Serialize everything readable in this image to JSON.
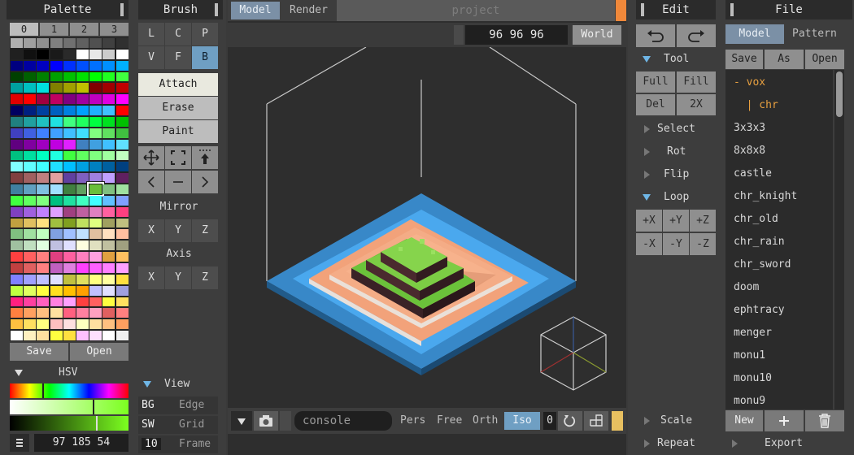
{
  "palette": {
    "title": "Palette",
    "tabs": [
      "0",
      "1",
      "2",
      "3"
    ],
    "save_label": "Save",
    "open_label": "Open",
    "hsv_label": "HSV",
    "color_value": "97 185 54",
    "colors": [
      [
        "#b0b0b0",
        "#a0a0a0",
        "#909090",
        "#808080",
        "#707070",
        "#606060",
        "#505050",
        "#404040",
        "#303030"
      ],
      [
        "#202020",
        "#101010",
        "#000000",
        "#1a1a1a",
        "#2a2a2a",
        "#ffffff",
        "#e8e8e8",
        "#cccccc",
        "#ffffff"
      ],
      [
        "#000080",
        "#0000a0",
        "#0000c0",
        "#0000ff",
        "#0030ff",
        "#0050ff",
        "#0070ff",
        "#0090ff",
        "#00b0ff"
      ],
      [
        "#004000",
        "#006000",
        "#008000",
        "#00a000",
        "#00c000",
        "#00e000",
        "#00ff00",
        "#20ff20",
        "#40ff40"
      ],
      [
        "#00a0a0",
        "#00c0c0",
        "#00e0e0",
        "#808000",
        "#a0a000",
        "#c0c000",
        "#800000",
        "#a00000",
        "#c00000"
      ],
      [
        "#e00000",
        "#ff0000",
        "#a00040",
        "#c00060",
        "#800080",
        "#a000a0",
        "#c000c0",
        "#e000e0",
        "#ff00ff"
      ],
      [
        "#000060",
        "#002080",
        "#0040a0",
        "#0060c0",
        "#0080e0",
        "#00a0ff",
        "#20b0ff",
        "#40c0ff",
        "#ff0000"
      ],
      [
        "#208080",
        "#20a0a0",
        "#20c0c0",
        "#20e0e0",
        "#40ff80",
        "#20ff60",
        "#00ff40",
        "#00e020",
        "#00c000"
      ],
      [
        "#4040c0",
        "#4060e0",
        "#4080ff",
        "#40a0ff",
        "#40c0ff",
        "#40e0ff",
        "#80ff80",
        "#60e060",
        "#40c040"
      ],
      [
        "#600080",
        "#8000a0",
        "#a000c0",
        "#c000e0",
        "#e020ff",
        "#4080c0",
        "#40a0e0",
        "#40c0ff",
        "#60e0ff"
      ],
      [
        "#00c080",
        "#00e0a0",
        "#00ffc0",
        "#20ffe0",
        "#40ff40",
        "#60ff60",
        "#80ff80",
        "#a0ffa0",
        "#c0ffc0"
      ],
      [
        "#80ffff",
        "#60ffff",
        "#40ffff",
        "#20e0ff",
        "#00c0ff",
        "#00a0e0",
        "#0080c0",
        "#0060a0",
        "#004080"
      ],
      [
        "#804040",
        "#a06060",
        "#c08080",
        "#e0a0a0",
        "#6040a0",
        "#8060c0",
        "#a080e0",
        "#c0a0ff",
        "#602060"
      ],
      [
        "#4080a0",
        "#60a0c0",
        "#80c0e0",
        "#a0e0ff",
        "#408040",
        "#60a060",
        "#6abf3a",
        "#80c080",
        "#a0e0a0"
      ],
      [
        "#40ff40",
        "#60ff60",
        "#80ff80",
        "#00c080",
        "#20e0a0",
        "#40ffc0",
        "#40ffff",
        "#60c0ff",
        "#80a0ff"
      ],
      [
        "#8040c0",
        "#a060e0",
        "#c080ff",
        "#e0a0ff",
        "#a04080",
        "#c060a0",
        "#e080c0",
        "#ff60a0",
        "#ff4080"
      ],
      [
        "#c0a040",
        "#e0c060",
        "#ffe080",
        "#a0c040",
        "#80a020",
        "#c0e060",
        "#e0ff80",
        "#a0a060",
        "#c0c080"
      ],
      [
        "#80c080",
        "#a0e0a0",
        "#c0ffc0",
        "#80a0e0",
        "#a0c0ff",
        "#c0e0ff",
        "#e0c0a0",
        "#ffe0c0",
        "#ffc0a0"
      ],
      [
        "#a0c0a0",
        "#c0e0c0",
        "#e0ffe0",
        "#c0c0e0",
        "#e0e0ff",
        "#ffffe0",
        "#e0e0c0",
        "#c0c0a0",
        "#a0a080"
      ],
      [
        "#ff4040",
        "#ff6060",
        "#ff8080",
        "#e04080",
        "#ff60a0",
        "#ff80c0",
        "#ffa0e0",
        "#e0a040",
        "#ffc060"
      ],
      [
        "#c04040",
        "#e06060",
        "#ff8080",
        "#c060c0",
        "#e080e0",
        "#ff40ff",
        "#ff60ff",
        "#ff80ff",
        "#ffa0ff"
      ],
      [
        "#8080ff",
        "#a0a0ff",
        "#c0c0ff",
        "#e0e0ff",
        "#c0c040",
        "#e0e060",
        "#ffff80",
        "#ffffa0",
        "#ffe040"
      ],
      [
        "#c0ff40",
        "#e0ff60",
        "#ffff40",
        "#ffe020",
        "#ffc000",
        "#ffa000",
        "#c0c0ff",
        "#e0e0ff",
        "#a0a0e0"
      ],
      [
        "#ff2080",
        "#ff40a0",
        "#ff60c0",
        "#ff80e0",
        "#ffa0ff",
        "#ff4040",
        "#ff6060",
        "#ffff40",
        "#ffe060"
      ],
      [
        "#ff8040",
        "#ffa060",
        "#ffc080",
        "#ffe0a0",
        "#ff6080",
        "#ff80a0",
        "#ffa0c0",
        "#e06060",
        "#ff8080"
      ],
      [
        "#ffc040",
        "#ffe060",
        "#ffff80",
        "#ffc0c0",
        "#ffe0e0",
        "#ffffc0",
        "#ffe0a0",
        "#ffc080",
        "#ffa060"
      ],
      [
        "#ffffff",
        "#fff0c0",
        "#ffe0a0",
        "#ffff40",
        "#ffe040",
        "#ffc0ff",
        "#ffe0ff",
        "#ffffff",
        "#f0f0f0"
      ]
    ]
  },
  "brush": {
    "title": "Brush",
    "modes_row1": [
      "L",
      "C",
      "P"
    ],
    "modes_row2": [
      "V",
      "F",
      "B"
    ],
    "actions": [
      "Attach",
      "Erase",
      "Paint"
    ],
    "mirror_label": "Mirror",
    "axis_label": "Axis",
    "axes": [
      "X",
      "Y",
      "Z"
    ],
    "view_label": "View",
    "view_rows": [
      {
        "key": "BG",
        "value": "Edge"
      },
      {
        "key": "SW",
        "value": "Grid"
      },
      {
        "key": "10",
        "value": "Frame"
      }
    ]
  },
  "viewport": {
    "tabs": [
      "Model",
      "Render"
    ],
    "project_placeholder": "project",
    "dims": "96 96 96",
    "space_label": "World",
    "console_placeholder": "console",
    "camera_modes": [
      "Pers",
      "Free",
      "Orth",
      "Iso"
    ],
    "active_camera": "Iso",
    "counter": "0"
  },
  "edit": {
    "title": "Edit",
    "tool_label": "Tool",
    "tool_buttons": [
      "Full",
      "Fill",
      "Del",
      "2X"
    ],
    "select_label": "Select",
    "rot_label": "Rot",
    "flip_label": "Flip",
    "loop_label": "Loop",
    "loop_buttons": [
      "+X",
      "+Y",
      "+Z",
      "-X",
      "-Y",
      "-Z"
    ],
    "scale_label": "Scale",
    "repeat_label": "Repeat"
  },
  "file": {
    "title": "File",
    "tabs": [
      "Model",
      "Pattern"
    ],
    "actions": [
      "Save",
      "As",
      "Open"
    ],
    "tree": [
      "- vox",
      "  | chr"
    ],
    "items": [
      "3x3x3",
      "8x8x8",
      "castle",
      "chr_knight",
      "chr_old",
      "chr_rain",
      "chr_sword",
      "doom",
      "ephtracy",
      "menger",
      "monu1",
      "monu10",
      "monu9"
    ],
    "new_label": "New",
    "export_label": "Export"
  },
  "colors": {
    "accent_blue": "#6f9fc3",
    "accent_orange": "#f0883a",
    "tree_orange": "#e8a040",
    "selected_swatch": "#6abf3a"
  }
}
